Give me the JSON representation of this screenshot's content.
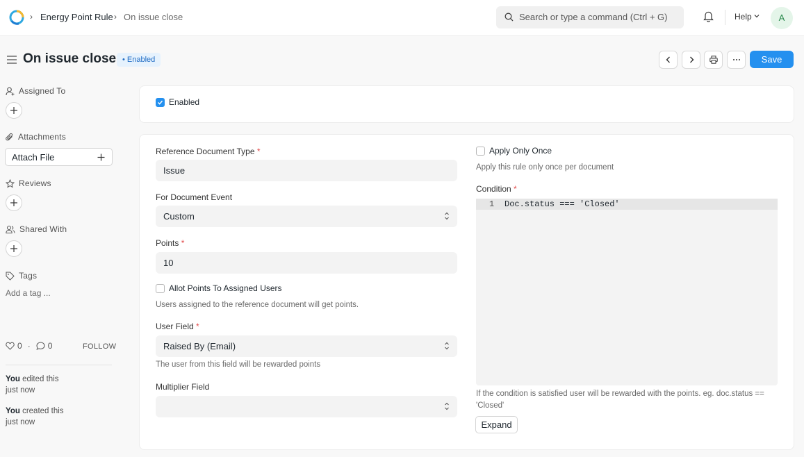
{
  "navbar": {
    "breadcrumbs": [
      "Energy Point Rule",
      "On issue close"
    ],
    "search_placeholder": "Search or type a command (Ctrl + G)",
    "help_label": "Help",
    "avatar_initial": "A"
  },
  "page": {
    "title": "On issue close",
    "status_badge": "Enabled",
    "save_label": "Save"
  },
  "sidebar": {
    "assigned_to": "Assigned To",
    "attachments": "Attachments",
    "attach_file": "Attach File",
    "reviews": "Reviews",
    "shared_with": "Shared With",
    "tags": "Tags",
    "add_tag": "Add a tag ...",
    "likes": "0",
    "comments": "0",
    "follow": "FOLLOW",
    "activity": [
      {
        "user": "You",
        "action": " edited this",
        "time": "just now"
      },
      {
        "user": "You",
        "action": " created this",
        "time": "just now"
      }
    ]
  },
  "form": {
    "enabled_label": "Enabled",
    "enabled_checked": true,
    "reference_doctype_label": "Reference Document Type",
    "reference_doctype_value": "Issue",
    "document_event_label": "For Document Event",
    "document_event_value": "Custom",
    "points_label": "Points",
    "points_value": "10",
    "allot_points_label": "Allot Points To Assigned Users",
    "allot_points_help": "Users assigned to the reference document will get points.",
    "user_field_label": "User Field",
    "user_field_value": "Raised By (Email)",
    "user_field_help": "The user from this field will be rewarded points",
    "multiplier_label": "Multiplier Field",
    "multiplier_value": "",
    "apply_once_label": "Apply Only Once",
    "apply_once_help": "Apply this rule only once per document",
    "condition_label": "Condition",
    "condition_line_no": "1",
    "condition_code": "Doc.status === 'Closed'",
    "condition_help_1": "If the condition is satisfied user will be rewarded with the points. eg. doc.status ==",
    "condition_help_2": "'Closed'",
    "expand_label": "Expand"
  },
  "required_mark": "*",
  "colors": {
    "primary": "#2490ef",
    "badge_bg": "#e6f2fd",
    "badge_text": "#1e6bc4",
    "required": "#e24c4c"
  }
}
